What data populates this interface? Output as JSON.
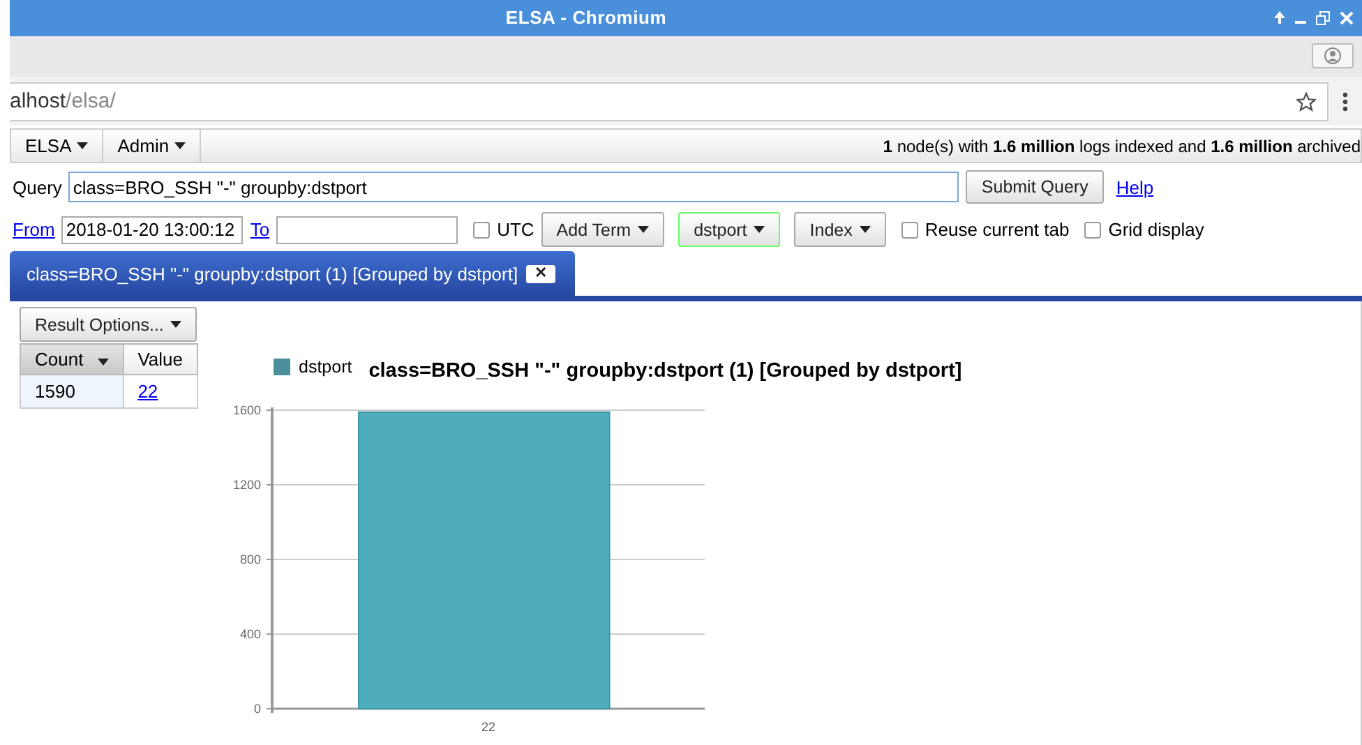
{
  "window": {
    "title": "ELSA - Chromium"
  },
  "address_bar": {
    "host": "alhost",
    "path": "/elsa/"
  },
  "menu": [
    {
      "label": "ELSA"
    },
    {
      "label": "Admin"
    }
  ],
  "status": "**1** node(s) with **1.6 million** logs indexed and **1.6 million** archived",
  "query": {
    "label": "Query",
    "value": "class=BRO_SSH \"-\" groupby:dstport",
    "submit": "Submit Query",
    "help": "Help"
  },
  "filters": {
    "from_label": "From",
    "from_value": "2018-01-20 13:00:12",
    "to_label": "To",
    "checkboxes": [
      {
        "label": "UTC",
        "checked": false
      }
    ],
    "buttons": [
      {
        "label": "Add Term",
        "active": false
      },
      {
        "label": "dstport",
        "active": true
      },
      {
        "label": "Index",
        "active": false
      }
    ],
    "options": [
      {
        "label": "Reuse current tab",
        "checked": false
      },
      {
        "label": "Grid display",
        "checked": false
      }
    ]
  },
  "result_tab": {
    "label": "class=BRO_SSH \"-\" groupby:dstport (1) [Grouped by dstport]",
    "close": "✕",
    "selected": true
  },
  "result_options": "Result Options...",
  "table": {
    "columns": [
      {
        "label": "Count",
        "sorted": true
      },
      {
        "label": "Value",
        "sorted": false
      }
    ],
    "rows": [
      {
        "count": "1590",
        "value": "22"
      }
    ]
  },
  "chart": {
    "chart_data": {
      "type": "bar",
      "grid": true,
      "title": "class=BRO_SSH \"-\" groupby:dstport (1) [Grouped by dstport]",
      "categories": [
        "22"
      ],
      "series": [
        {
          "name": "dstport",
          "color": "#4fadbb",
          "values": [
            1590
          ]
        }
      ],
      "ylim": [
        0,
        1600
      ],
      "yticks": [
        0,
        400,
        800,
        1200,
        1600
      ]
    }
  }
}
